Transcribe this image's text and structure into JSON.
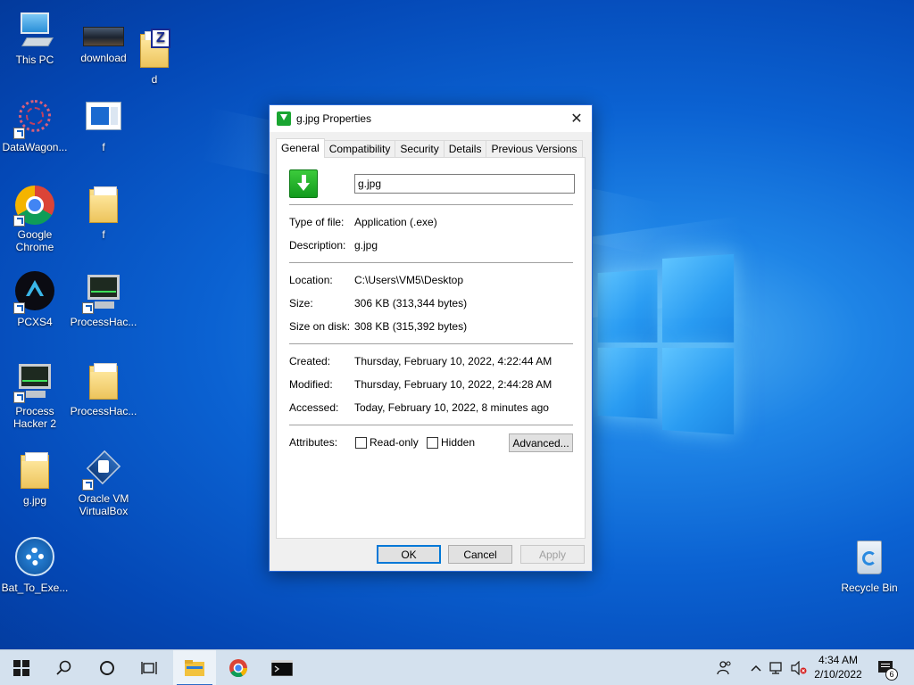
{
  "desktop": {
    "icons": [
      {
        "label": "This PC"
      },
      {
        "label": "download"
      },
      {
        "label": "d"
      },
      {
        "label": "DataWagon..."
      },
      {
        "label": "f"
      },
      {
        "label": "Google Chrome"
      },
      {
        "label": "f"
      },
      {
        "label": "PCXS4"
      },
      {
        "label": "ProcessHac..."
      },
      {
        "label": "Process Hacker 2"
      },
      {
        "label": "ProcessHac..."
      },
      {
        "label": "g.jpg"
      },
      {
        "label": "Oracle VM VirtualBox"
      },
      {
        "label": "Bat_To_Exe..."
      },
      {
        "label": "Recycle Bin"
      }
    ]
  },
  "dialog": {
    "title": "g.jpg Properties",
    "close_glyph": "✕",
    "tabs": [
      "General",
      "Compatibility",
      "Security",
      "Details",
      "Previous Versions"
    ],
    "file_name": "g.jpg",
    "type_label": "Type of file:",
    "type_value": "Application (.exe)",
    "desc_label": "Description:",
    "desc_value": "g.jpg",
    "location_label": "Location:",
    "location_value": "C:\\Users\\VM5\\Desktop",
    "size_label": "Size:",
    "size_value": "306 KB (313,344 bytes)",
    "disk_label": "Size on disk:",
    "disk_value": "308 KB (315,392 bytes)",
    "created_label": "Created:",
    "created_value": "Thursday, February 10, 2022, 4:22:44 AM",
    "modified_label": "Modified:",
    "modified_value": "Thursday, February 10, 2022, 2:44:28 AM",
    "accessed_label": "Accessed:",
    "accessed_value": "Today, February 10, 2022, 8 minutes ago",
    "attributes_label": "Attributes:",
    "readonly_label": "Read-only",
    "hidden_label": "Hidden",
    "advanced_label": "Advanced...",
    "ok_label": "OK",
    "cancel_label": "Cancel",
    "apply_label": "Apply"
  },
  "taskbar": {
    "time": "4:34 AM",
    "date": "2/10/2022",
    "notification_count": "6"
  },
  "colors": {
    "accent": "#0078d7",
    "taskbar": "#d4e1ee"
  }
}
